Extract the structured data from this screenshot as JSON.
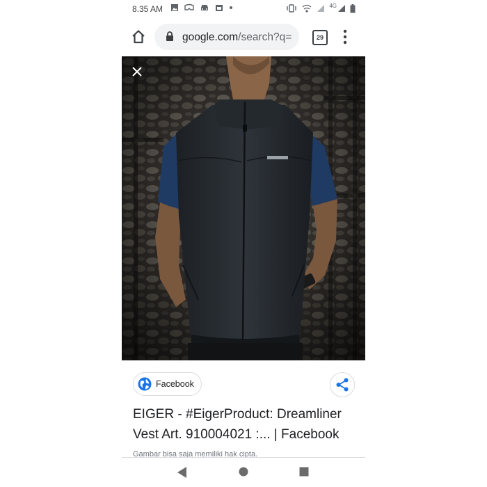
{
  "status_bar": {
    "time": "8.35 AM",
    "network": "4G",
    "icons": [
      "image-icon",
      "vr-icon",
      "car-icon",
      "calendar-icon",
      "dot-icon",
      "vibrate-icon",
      "wifi-calling-icon",
      "signal-icon",
      "battery-icon"
    ]
  },
  "browser": {
    "url_host": "google.com",
    "url_path": "/search?q=",
    "tab_count": "29"
  },
  "result": {
    "source": "Facebook",
    "title": "EIGER - #EigerProduct: Dreamliner Vest Art. 910004021 :... | Facebook",
    "disclaimer": "Gambar bisa saja memiliki hak cipta."
  },
  "colors": {
    "accent_blue": "#1a73e8",
    "omnibox_bg": "#f1f3f4",
    "photo_bg": "#2b2926"
  }
}
